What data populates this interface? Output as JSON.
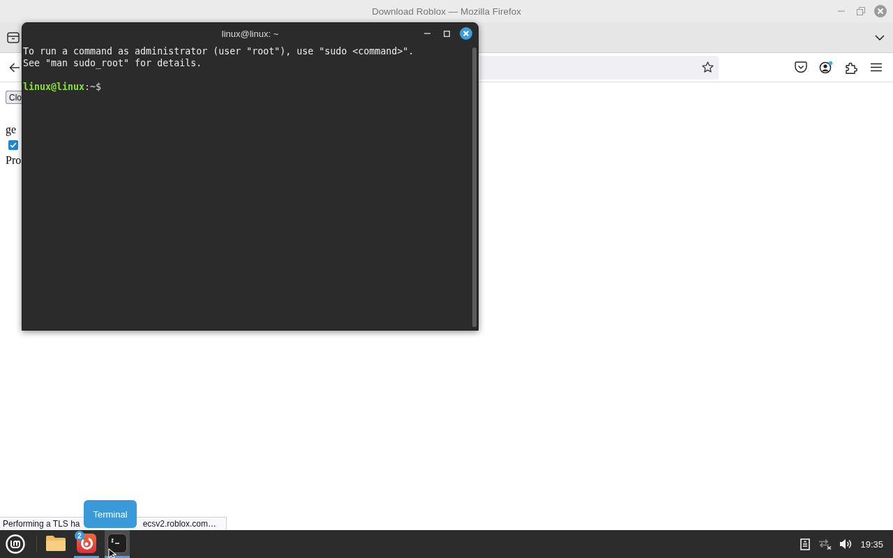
{
  "browser": {
    "title": "Download Roblox — Mozilla Firefox",
    "page": {
      "button_label": "Clo",
      "text_1": "ge",
      "checkbox": {
        "checked": true
      },
      "text_2": "Pro"
    },
    "status_bar": [
      "Performing a TLS ha",
      "ecsv2.roblox.com…"
    ]
  },
  "terminal": {
    "title": "linux@linux: ~",
    "lines": [
      "To run a command as administrator (user \"root\"), use \"sudo <command>\".",
      "See \"man sudo_root\" for details."
    ],
    "prompt": {
      "user_host": "linux@linux",
      "path": ":~$"
    }
  },
  "tooltip": "Terminal",
  "taskbar": {
    "apps": [
      {
        "kind": "folder",
        "running": false,
        "selected": false
      },
      {
        "kind": "swirl",
        "running": true,
        "selected": false,
        "badge": "2"
      },
      {
        "kind": "terminal",
        "running": true,
        "selected": true
      }
    ],
    "clock": "19:35"
  }
}
